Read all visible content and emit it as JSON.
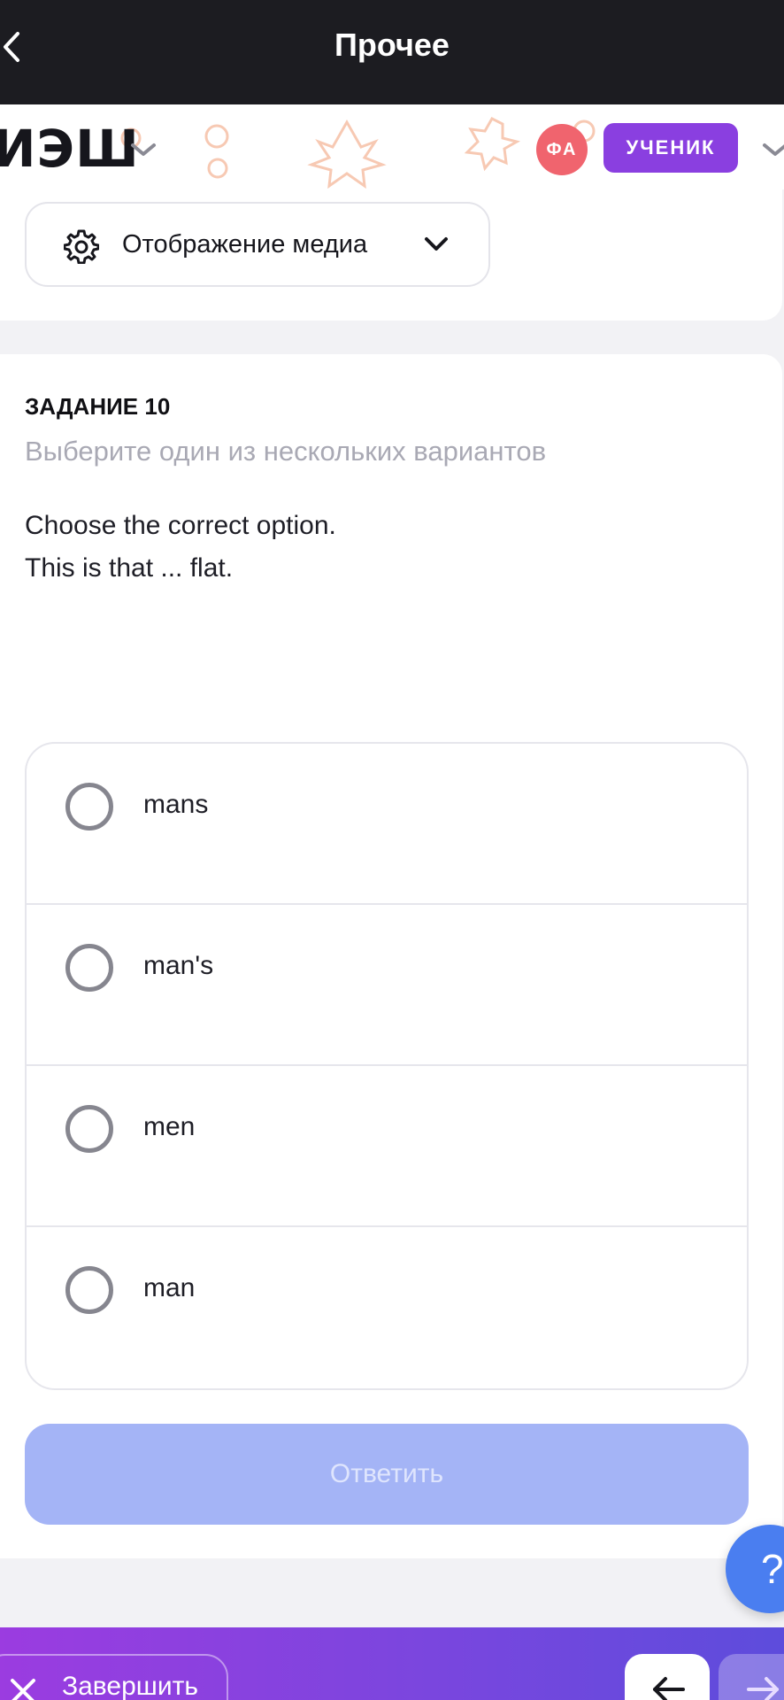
{
  "topbar": {
    "title": "Прочее",
    "back_icon": "chevron-left-icon"
  },
  "header": {
    "logo": "ИЭШ",
    "avatar_initials": "ФА",
    "role_label": "УЧЕНИК"
  },
  "media": {
    "label": "Отображение медиа",
    "icon": "gear-icon"
  },
  "task": {
    "title": "ЗАДАНИЕ 10",
    "subtitle": "Выберите один из нескольких вариантов",
    "question_line1": "Choose the correct option.",
    "question_line2": "This is that ... flat.",
    "options": [
      "mans",
      "man's",
      "men",
      "man"
    ],
    "answer_label": "Ответить"
  },
  "help": {
    "label": "?"
  },
  "bottombar": {
    "finish_label": "Завершить"
  },
  "colors": {
    "accent_purple": "#8a3fe0",
    "avatar_red": "#f0646e",
    "answer_disabled": "#a4b4f6",
    "help_blue": "#4a7ef0"
  }
}
